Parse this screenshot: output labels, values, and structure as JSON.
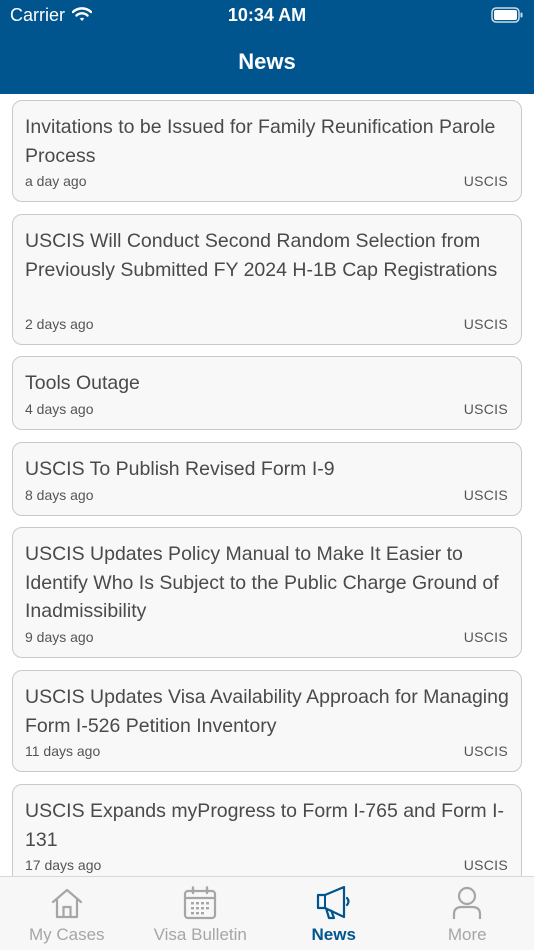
{
  "status_bar": {
    "carrier": "Carrier",
    "time": "10:34 AM"
  },
  "nav": {
    "title": "News"
  },
  "news": [
    {
      "title": "Invitations to be Issued for Family Reunification Parole Process",
      "date": "a day ago",
      "source": "USCIS"
    },
    {
      "title": "USCIS Will Conduct Second Random Selection from Previously Submitted FY 2024 H-1B Cap Registrations",
      "date": "2 days ago",
      "source": "USCIS"
    },
    {
      "title": "Tools Outage",
      "date": "4 days ago",
      "source": "USCIS"
    },
    {
      "title": "USCIS To Publish Revised Form I-9",
      "date": "8 days ago",
      "source": "USCIS"
    },
    {
      "title": "USCIS Updates Policy Manual to Make It Easier to Identify Who Is Subject to the Public Charge Ground of Inadmissibility",
      "date": "9 days ago",
      "source": "USCIS"
    },
    {
      "title": "USCIS Updates Visa Availability Approach for Managing Form I-526 Petition Inventory",
      "date": "11 days ago",
      "source": "USCIS"
    },
    {
      "title": "USCIS Expands myProgress to Form I-765 and Form I-131",
      "date": "17 days ago",
      "source": "USCIS"
    }
  ],
  "tabs": [
    {
      "label": "My Cases",
      "icon": "home-icon"
    },
    {
      "label": "Visa Bulletin",
      "icon": "calendar-icon"
    },
    {
      "label": "News",
      "icon": "megaphone-icon",
      "active": true
    },
    {
      "label": "More",
      "icon": "person-icon"
    }
  ],
  "colors": {
    "brand": "#01558f",
    "inactive_tab": "#a6a6a6"
  }
}
